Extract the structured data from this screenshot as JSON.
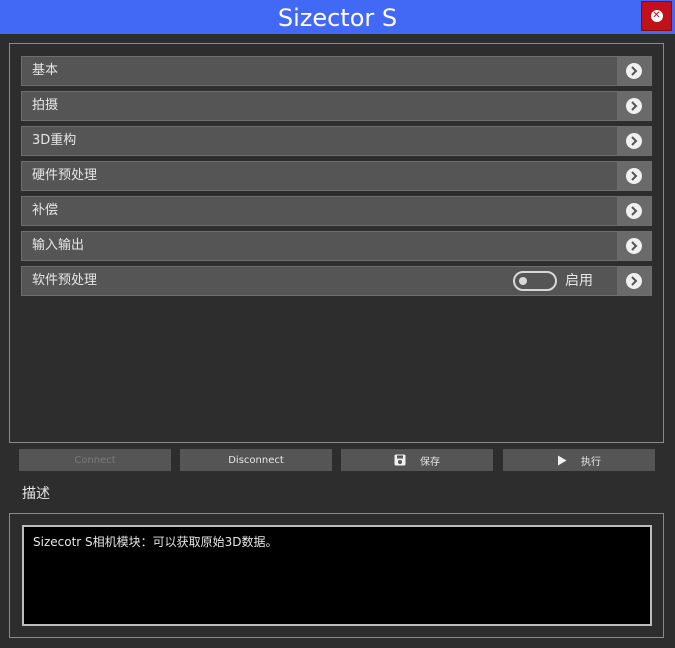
{
  "window": {
    "title": "Sizector S"
  },
  "menu": {
    "items": [
      {
        "label": "基本"
      },
      {
        "label": "拍摄"
      },
      {
        "label": "3D重构"
      },
      {
        "label": "硬件预处理"
      },
      {
        "label": "补偿"
      },
      {
        "label": "输入输出"
      },
      {
        "label": "软件预处理",
        "toggle_label": "启用",
        "toggle_on": false
      }
    ]
  },
  "actions": {
    "connect": "Connect",
    "disconnect": "Disconnect",
    "save": "保存",
    "run": "执行"
  },
  "description": {
    "title": "描述",
    "text": "Sizecotr S相机模块：可以获取原始3D数据。"
  },
  "colors": {
    "titlebar": "#4169f5",
    "close": "#c0101a",
    "background": "#2d2d2d",
    "item": "#555555"
  }
}
